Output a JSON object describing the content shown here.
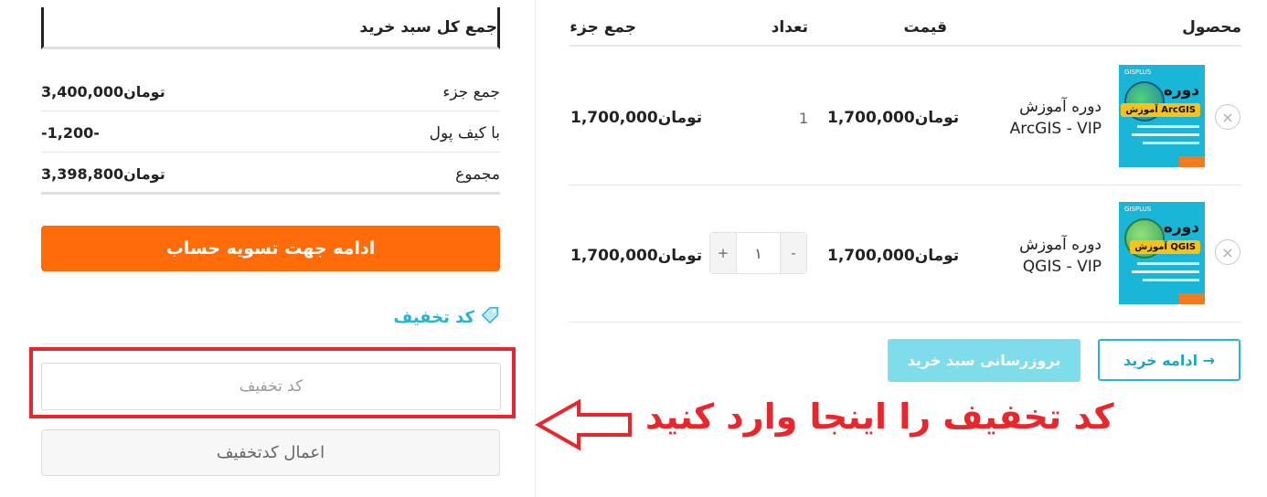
{
  "cart": {
    "headers": {
      "product": "محصول",
      "price": "قیمت",
      "quantity": "تعداد",
      "subtotal": "جمع جزء"
    },
    "items": [
      {
        "name": "دوره آموزش ArcGIS - VIP",
        "price": "1,700,000تومان",
        "quantity": "1",
        "subtotal": "1,700,000تومان",
        "thumb_title": "دوره",
        "thumb_chip": "آموزش ArcGIS",
        "thumb_brand": "GISPLUS"
      },
      {
        "name": "دوره آموزش QGIS - VIP",
        "price": "1,700,000تومان",
        "quantity": "١",
        "subtotal": "1,700,000تومان",
        "thumb_title": "دوره",
        "thumb_chip": "آموزش QGIS",
        "thumb_brand": "GISPLUS"
      }
    ],
    "remove_symbol": "×",
    "stepper": {
      "minus": "-",
      "plus": "+"
    },
    "update_button": "بروزرسانی سبد خرید",
    "continue_button": "→ ادامه خرید"
  },
  "totals": {
    "title": "جمع کل سبد خرید",
    "rows": [
      {
        "label": "جمع جزء",
        "value": "3,400,000تومان"
      },
      {
        "label": "با کیف پول",
        "value": "-1,200-"
      },
      {
        "label": "مجموع",
        "value": "3,398,800تومان"
      }
    ],
    "checkout_button": "ادامه جهت تسویه حساب"
  },
  "coupon": {
    "title": "کد تخفیف",
    "placeholder": "کد تخفیف",
    "apply_button": "اعمال کدتخفیف"
  },
  "annotation": {
    "text": "کد تخفیف را اینجا وارد کنید",
    "color": "#e8262c"
  },
  "colors": {
    "accent_orange": "#ff6b08",
    "accent_cyan": "#26b6d3"
  }
}
